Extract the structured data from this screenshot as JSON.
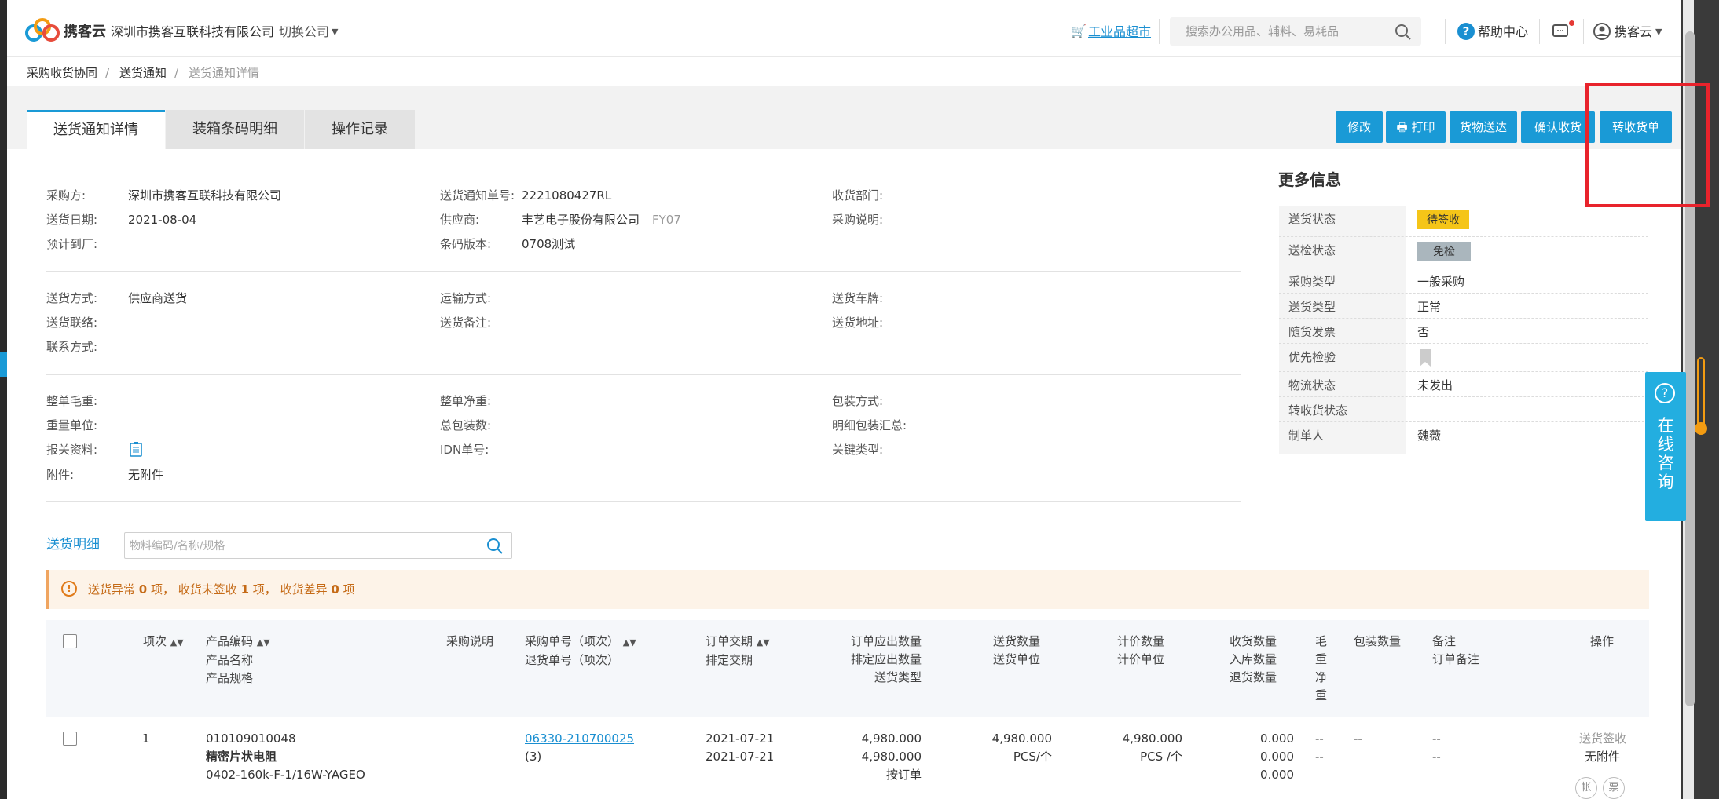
{
  "header": {
    "logo_text": "携客云",
    "company": "深圳市携客互联科技有限公司",
    "switch_company": "切换公司",
    "market_link": "工业品超市",
    "search_placeholder": "搜索办公用品、辅料、易耗品",
    "help": "帮助中心",
    "user": "携客云"
  },
  "breadcrumb": [
    "采购收货协同",
    "送货通知",
    "送货通知详情"
  ],
  "tabs": [
    "送货通知详情",
    "装箱条码明细",
    "操作记录"
  ],
  "actions": [
    "修改",
    "打印",
    "货物送达",
    "确认收货",
    "转收货单"
  ],
  "info": {
    "buyer_label": "采购方:",
    "buyer": "深圳市携客互联科技有限公司",
    "notice_no_label": "送货通知单号:",
    "notice_no": "2221080427RL",
    "dept_label": "收货部门:",
    "date_label": "送货日期:",
    "date": "2021-08-04",
    "supplier_label": "供应商:",
    "supplier": "丰艺电子股份有限公司",
    "supplier_code": "FY07",
    "purchase_note_label": "采购说明:",
    "eta_label": "预计到厂:",
    "barcode_ver_label": "条码版本:",
    "barcode_ver": "0708测试",
    "ship_method_label": "送货方式:",
    "ship_method": "供应商送货",
    "transport_label": "运输方式:",
    "plate_label": "送货车牌:",
    "contact_label": "送货联络:",
    "remark_label": "送货备注:",
    "address_label": "送货地址:",
    "phone_label": "联系方式:",
    "gross_label": "整单毛重:",
    "net_label": "整单净重:",
    "pack_method_label": "包装方式:",
    "weight_unit_label": "重量单位:",
    "total_pack_label": "总包装数:",
    "pack_summary_label": "明细包装汇总:",
    "customs_label": "报关资料:",
    "idn_label": "IDN单号:",
    "key_type_label": "关键类型:",
    "attach_label": "附件:",
    "attach": "无附件"
  },
  "more": {
    "title": "更多信息",
    "rows": [
      {
        "k": "送货状态",
        "v": "待签收"
      },
      {
        "k": "送检状态",
        "v": "免检"
      },
      {
        "k": "采购类型",
        "v": "一般采购"
      },
      {
        "k": "送货类型",
        "v": "正常"
      },
      {
        "k": "随货发票",
        "v": "否"
      },
      {
        "k": "优先检验",
        "v": ""
      },
      {
        "k": "物流状态",
        "v": "未发出"
      },
      {
        "k": "转收货状态",
        "v": ""
      },
      {
        "k": "制单人",
        "v": "魏薇"
      }
    ]
  },
  "detail": {
    "title": "送货明细",
    "search_placeholder": "物料编码/名称/规格",
    "alert_prefix": "送货异常",
    "alert_n1": "0",
    "alert_mid1": "项， 收货未签收",
    "alert_n2": "1",
    "alert_mid2": "项， 收货差异",
    "alert_n3": "0",
    "alert_suffix": "项"
  },
  "table": {
    "headers": {
      "seq": "项次",
      "product": [
        "产品编码",
        "产品名称",
        "产品规格"
      ],
      "purchase_note": "采购说明",
      "po": [
        "采购单号（项次）",
        "退货单号（项次）"
      ],
      "dates": [
        "订单交期",
        "排定交期"
      ],
      "order_qty": [
        "订单应出数量",
        "排定应出数量",
        "送货类型"
      ],
      "ship_qty": [
        "送货数量",
        "送货单位"
      ],
      "price_qty": [
        "计价数量",
        "计价单位"
      ],
      "recv_qty": [
        "收货数量",
        "入库数量",
        "退货数量"
      ],
      "weight": [
        "毛",
        "重",
        "净",
        "重"
      ],
      "pack_qty": "包装数量",
      "remark": [
        "备注",
        "订单备注"
      ],
      "op": "操作"
    },
    "row": {
      "seq": "1",
      "code": "010109010048",
      "name": "精密片状电阻",
      "spec": "0402-160k-F-1/16W-YAGEO",
      "po": "06330-210700025",
      "po_seq": "(3)",
      "order_date": "2021-07-21",
      "plan_date": "2021-07-21",
      "order_qty": "4,980.000",
      "plan_qty": "4,980.000",
      "ship_type": "按订单",
      "ship_qty": "4,980.000",
      "ship_unit": "PCS/个",
      "price_qty": "4,980.000",
      "price_unit": "PCS /个",
      "recv": "0.000",
      "stock": "0.000",
      "ret": "0.000",
      "gw": "--",
      "nw": "--",
      "pack": "--",
      "remark1": "--",
      "remark2": "--",
      "op1": "送货签收",
      "op2": "无附件",
      "op3": "帐",
      "op4": "票"
    }
  },
  "float_help": "在线咨询"
}
